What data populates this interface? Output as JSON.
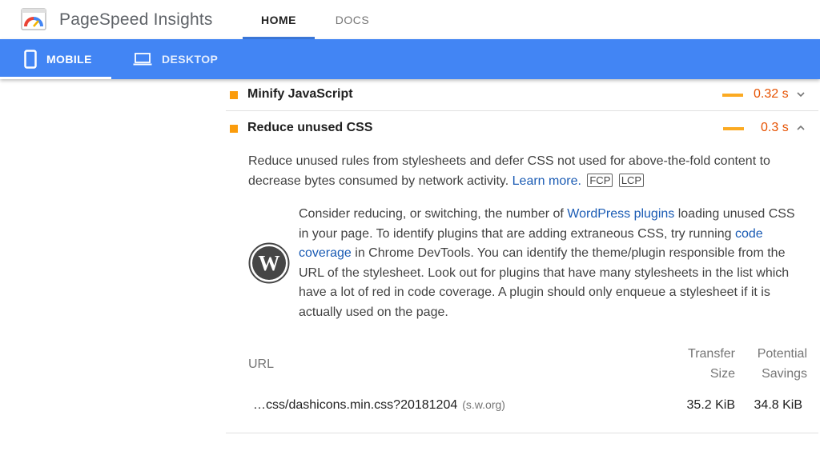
{
  "header": {
    "app_title": "PageSpeed Insights",
    "logo_icon": "pagespeed-gauge-icon",
    "tabs": [
      {
        "label": "HOME",
        "active": true
      },
      {
        "label": "DOCS",
        "active": false
      }
    ]
  },
  "device_bar": {
    "color": "#4285f4",
    "tabs": [
      {
        "label": "MOBILE",
        "icon": "phone-icon",
        "active": true
      },
      {
        "label": "DESKTOP",
        "icon": "laptop-icon",
        "active": false
      }
    ]
  },
  "audits": [
    {
      "title": "Minify JavaScript",
      "value": "0.32 s",
      "expanded": false,
      "status_color": "#fb9c0c"
    },
    {
      "title": "Reduce unused CSS",
      "value": "0.3 s",
      "expanded": true,
      "status_color": "#fb9c0c"
    }
  ],
  "details": {
    "description_text": "Reduce unused rules from stylesheets and defer CSS not used for above-the-fold content to decrease bytes consumed by network activity.",
    "learn_more": "Learn more.",
    "chips": [
      "FCP",
      "LCP"
    ],
    "wp": {
      "icon": "wordpress-logo-icon",
      "text_1": "Consider reducing, or switching, the number of ",
      "link_1": "WordPress plugins",
      "text_2": " loading unused CSS in your page. To identify plugins that are adding extraneous CSS, try running ",
      "link_2": "code coverage",
      "text_3": " in Chrome DevTools. You can identify the theme/plugin responsible from the URL of the stylesheet. Look out for plugins that have many stylesheets in the list which have a lot of red in code coverage. A plugin should only enqueue a stylesheet if it is actually used on the page."
    },
    "table": {
      "col_url": "URL",
      "col_transfer_1": "Transfer",
      "col_transfer_2": "Size",
      "col_savings_1": "Potential",
      "col_savings_2": "Savings",
      "rows": [
        {
          "url": "…css/dashicons.min.css?20181204",
          "host": "(s.w.org)",
          "transfer": "35.2 KiB",
          "savings": "34.8 KiB"
        }
      ]
    }
  }
}
